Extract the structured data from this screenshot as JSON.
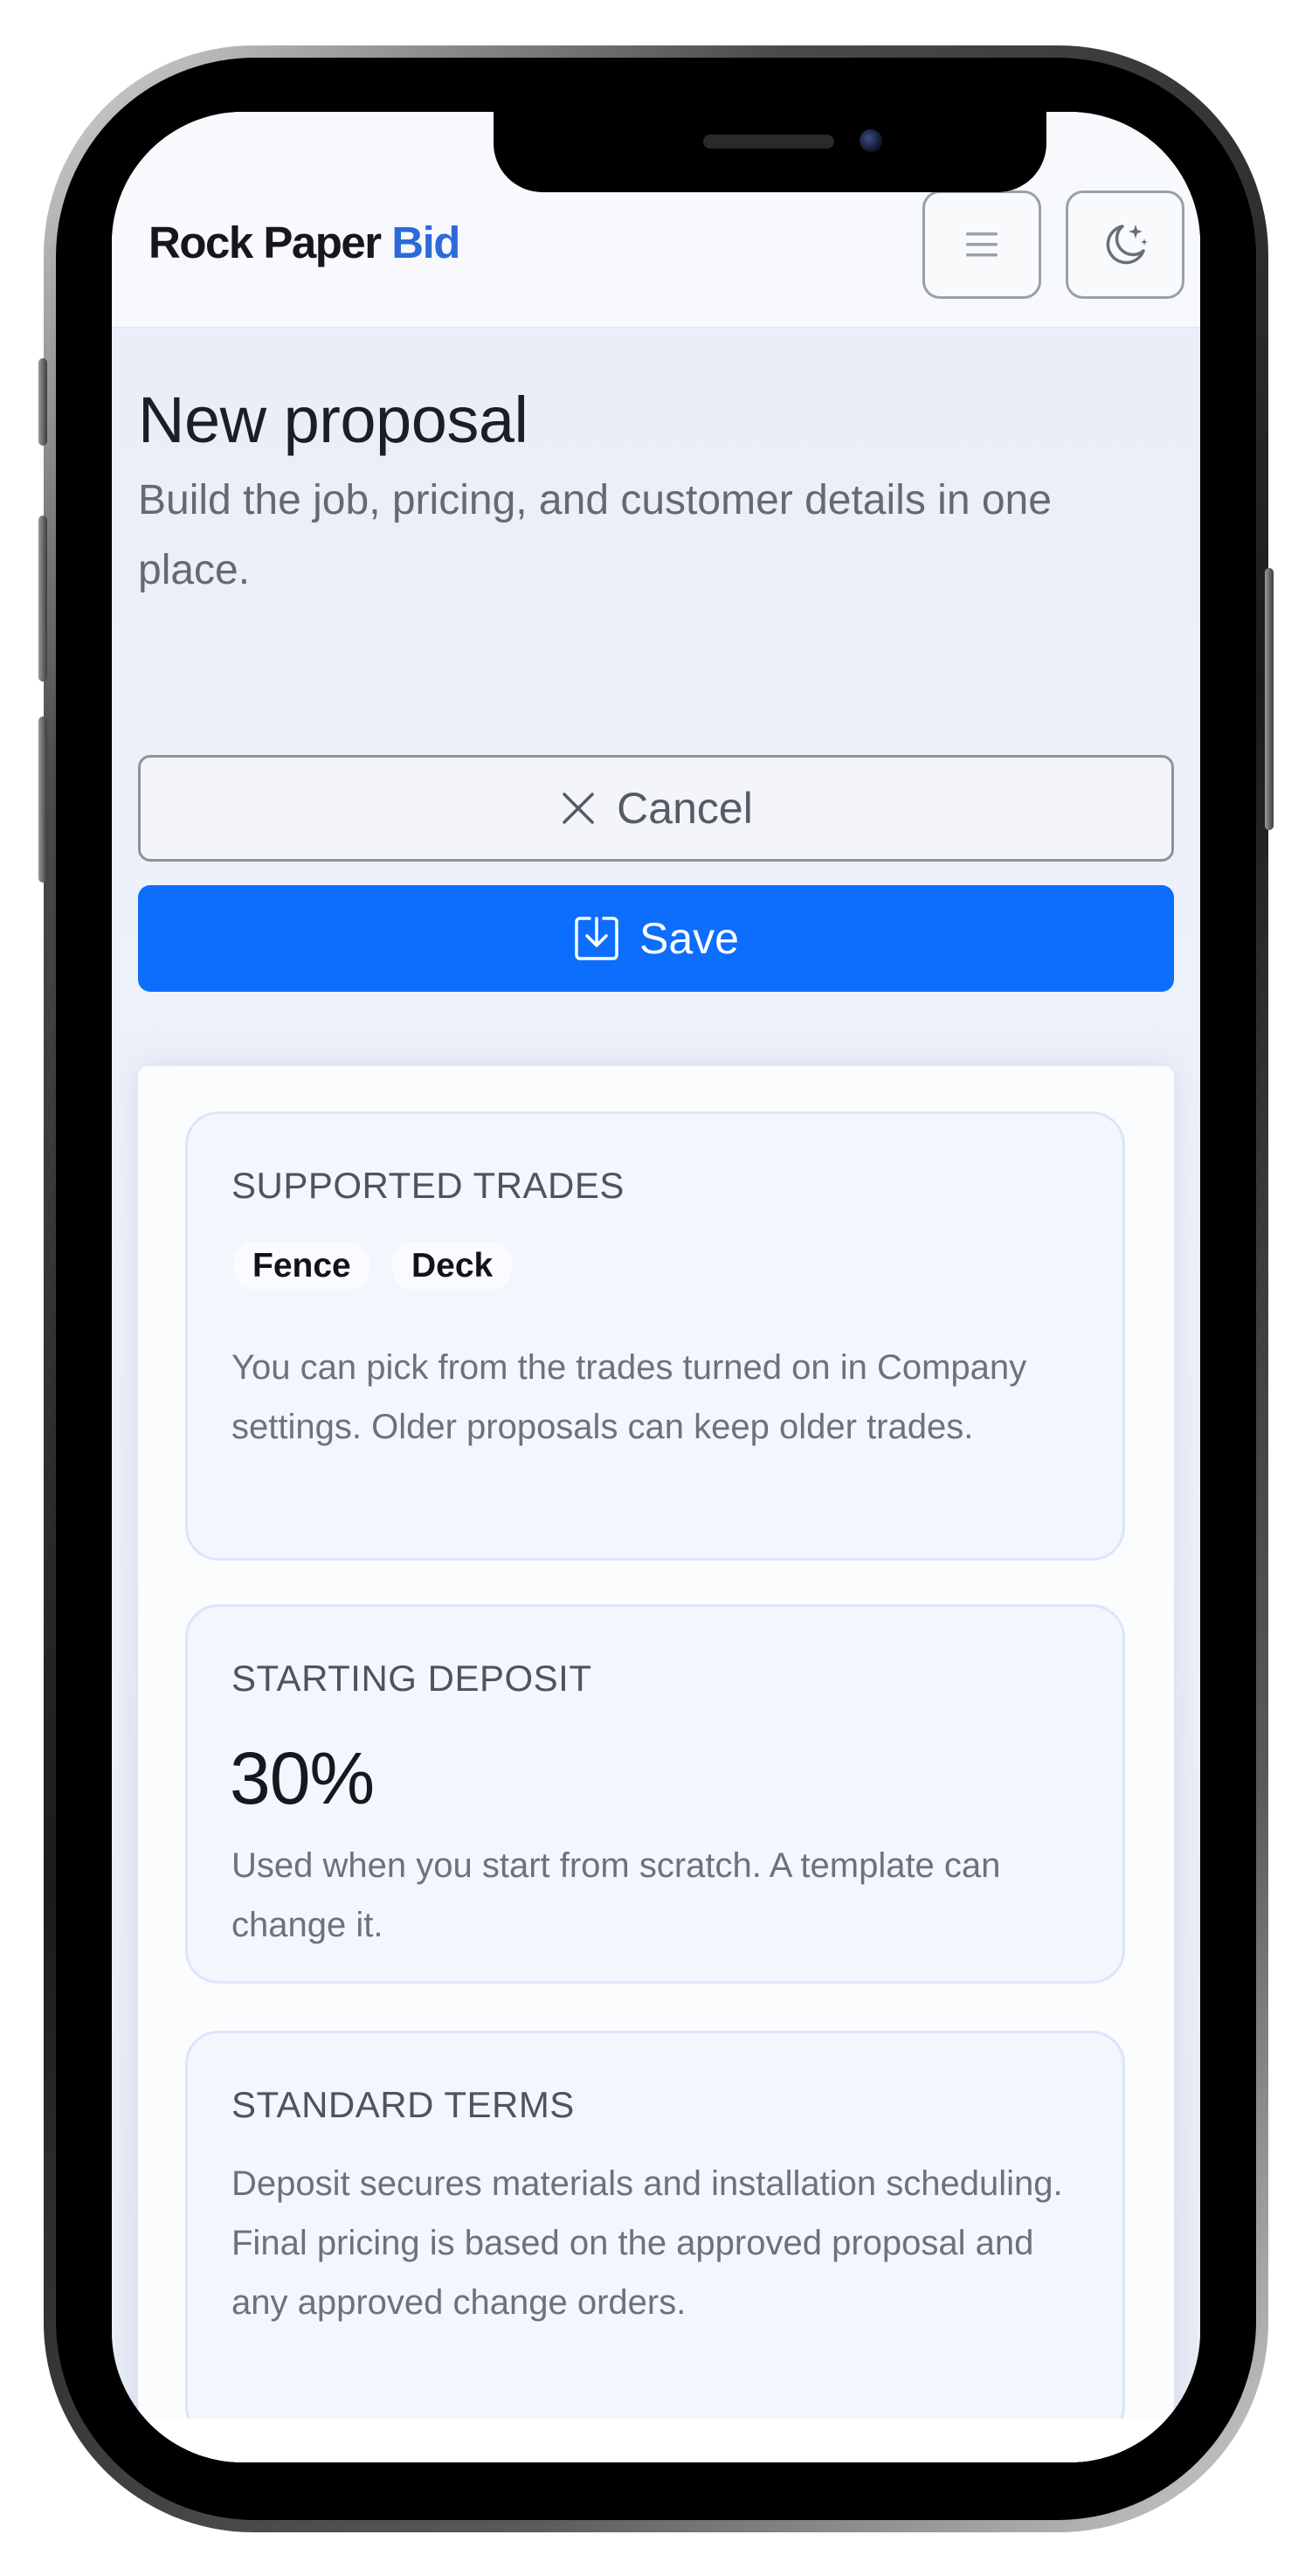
{
  "header": {
    "brand_main": "Rock Paper",
    "brand_accent": "Bid",
    "menu_icon": "hamburger-icon",
    "theme_icon": "moon-stars-icon"
  },
  "page": {
    "title": "New proposal",
    "subtitle": "Build the job, pricing, and customer details in one place."
  },
  "actions": {
    "cancel_label": "Cancel",
    "cancel_icon": "close-icon",
    "save_label": "Save",
    "save_icon": "save-icon"
  },
  "cards": {
    "trades": {
      "label": "SUPPORTED TRADES",
      "chips": [
        "Fence",
        "Deck"
      ],
      "body": "You can pick from the trades turned on in Company settings. Older proposals can keep older trades."
    },
    "deposit": {
      "label": "STARTING DEPOSIT",
      "value": "30%",
      "body": "Used when you start from scratch. A template can change it."
    },
    "terms": {
      "label": "STANDARD TERMS",
      "body": "Deposit secures materials and installation scheduling. Final pricing is based on the approved proposal and any approved change orders."
    }
  },
  "colors": {
    "accent": "#0d6efd",
    "brand_accent": "#2c6ad8",
    "card_border": "#dbe6fa"
  }
}
